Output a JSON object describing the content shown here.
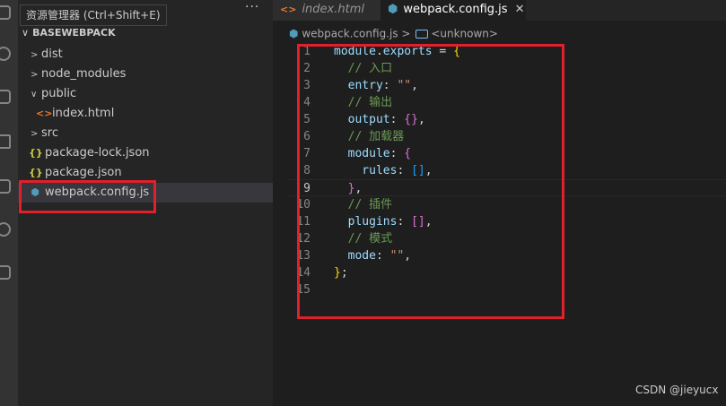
{
  "tooltip": "资源管理器 (Ctrl+Shift+E)",
  "explorer": {
    "more_label": "···",
    "section_title": "BASEWEBPACK",
    "items": [
      {
        "label": "dist",
        "kind": "folder",
        "chevron": ">"
      },
      {
        "label": "node_modules",
        "kind": "folder",
        "chevron": ">"
      },
      {
        "label": "public",
        "kind": "folder",
        "chevron": "∨"
      },
      {
        "label": "index.html",
        "kind": "html"
      },
      {
        "label": "src",
        "kind": "folder",
        "chevron": ">"
      },
      {
        "label": "package-lock.json",
        "kind": "json"
      },
      {
        "label": "package.json",
        "kind": "json"
      },
      {
        "label": "webpack.config.js",
        "kind": "js",
        "selected": true
      }
    ]
  },
  "tabs": [
    {
      "label": "index.html",
      "active": false
    },
    {
      "label": "webpack.config.js",
      "active": true,
      "close": "✕"
    }
  ],
  "breadcrumb": {
    "file": "webpack.config.js",
    "separator": ">",
    "symbol": "<unknown>"
  },
  "editor": {
    "current_line": 9,
    "lines": [
      {
        "n": "1",
        "tokens": [
          [
            "kw",
            "module"
          ],
          [
            "",
            "."
          ],
          [
            "kw",
            "exports"
          ],
          [
            "",
            " = "
          ],
          [
            "br1",
            "{"
          ]
        ]
      },
      {
        "n": "2",
        "tokens": [
          [
            "cm",
            "  // 入口"
          ]
        ]
      },
      {
        "n": "3",
        "tokens": [
          [
            "kw",
            "  entry"
          ],
          [
            "",
            ": "
          ],
          [
            "st",
            "\"\""
          ],
          [
            "",
            ","
          ]
        ]
      },
      {
        "n": "4",
        "tokens": [
          [
            "cm",
            "  // 输出"
          ]
        ]
      },
      {
        "n": "5",
        "tokens": [
          [
            "kw",
            "  output"
          ],
          [
            "",
            ": "
          ],
          [
            "br2",
            "{}"
          ],
          [
            "",
            ","
          ]
        ]
      },
      {
        "n": "6",
        "tokens": [
          [
            "cm",
            "  // 加载器"
          ]
        ]
      },
      {
        "n": "7",
        "tokens": [
          [
            "kw",
            "  module"
          ],
          [
            "",
            ": "
          ],
          [
            "br2",
            "{"
          ]
        ]
      },
      {
        "n": "8",
        "tokens": [
          [
            "kw",
            "    rules"
          ],
          [
            "",
            ": "
          ],
          [
            "br3",
            "[]"
          ],
          [
            "",
            ","
          ]
        ]
      },
      {
        "n": "9",
        "tokens": [
          [
            "br2",
            "  }"
          ],
          [
            "",
            ","
          ]
        ]
      },
      {
        "n": "10",
        "tokens": [
          [
            "cm",
            "  // 插件"
          ]
        ]
      },
      {
        "n": "11",
        "tokens": [
          [
            "kw",
            "  plugins"
          ],
          [
            "",
            ": "
          ],
          [
            "br2",
            "[]"
          ],
          [
            "",
            ","
          ]
        ]
      },
      {
        "n": "12",
        "tokens": [
          [
            "cm",
            "  // 模式"
          ]
        ]
      },
      {
        "n": "13",
        "tokens": [
          [
            "kw",
            "  mode"
          ],
          [
            "",
            ": "
          ],
          [
            "st",
            "\"\""
          ],
          [
            "",
            ","
          ]
        ]
      },
      {
        "n": "14",
        "tokens": [
          [
            "br1",
            "}"
          ],
          [
            "",
            ";"
          ]
        ]
      },
      {
        "n": "15",
        "tokens": []
      }
    ]
  },
  "watermark": "CSDN @jieyucx",
  "colors": {
    "highlight_box": "#e0202b",
    "background": "#1e1e1e",
    "sidebar": "#252526"
  }
}
